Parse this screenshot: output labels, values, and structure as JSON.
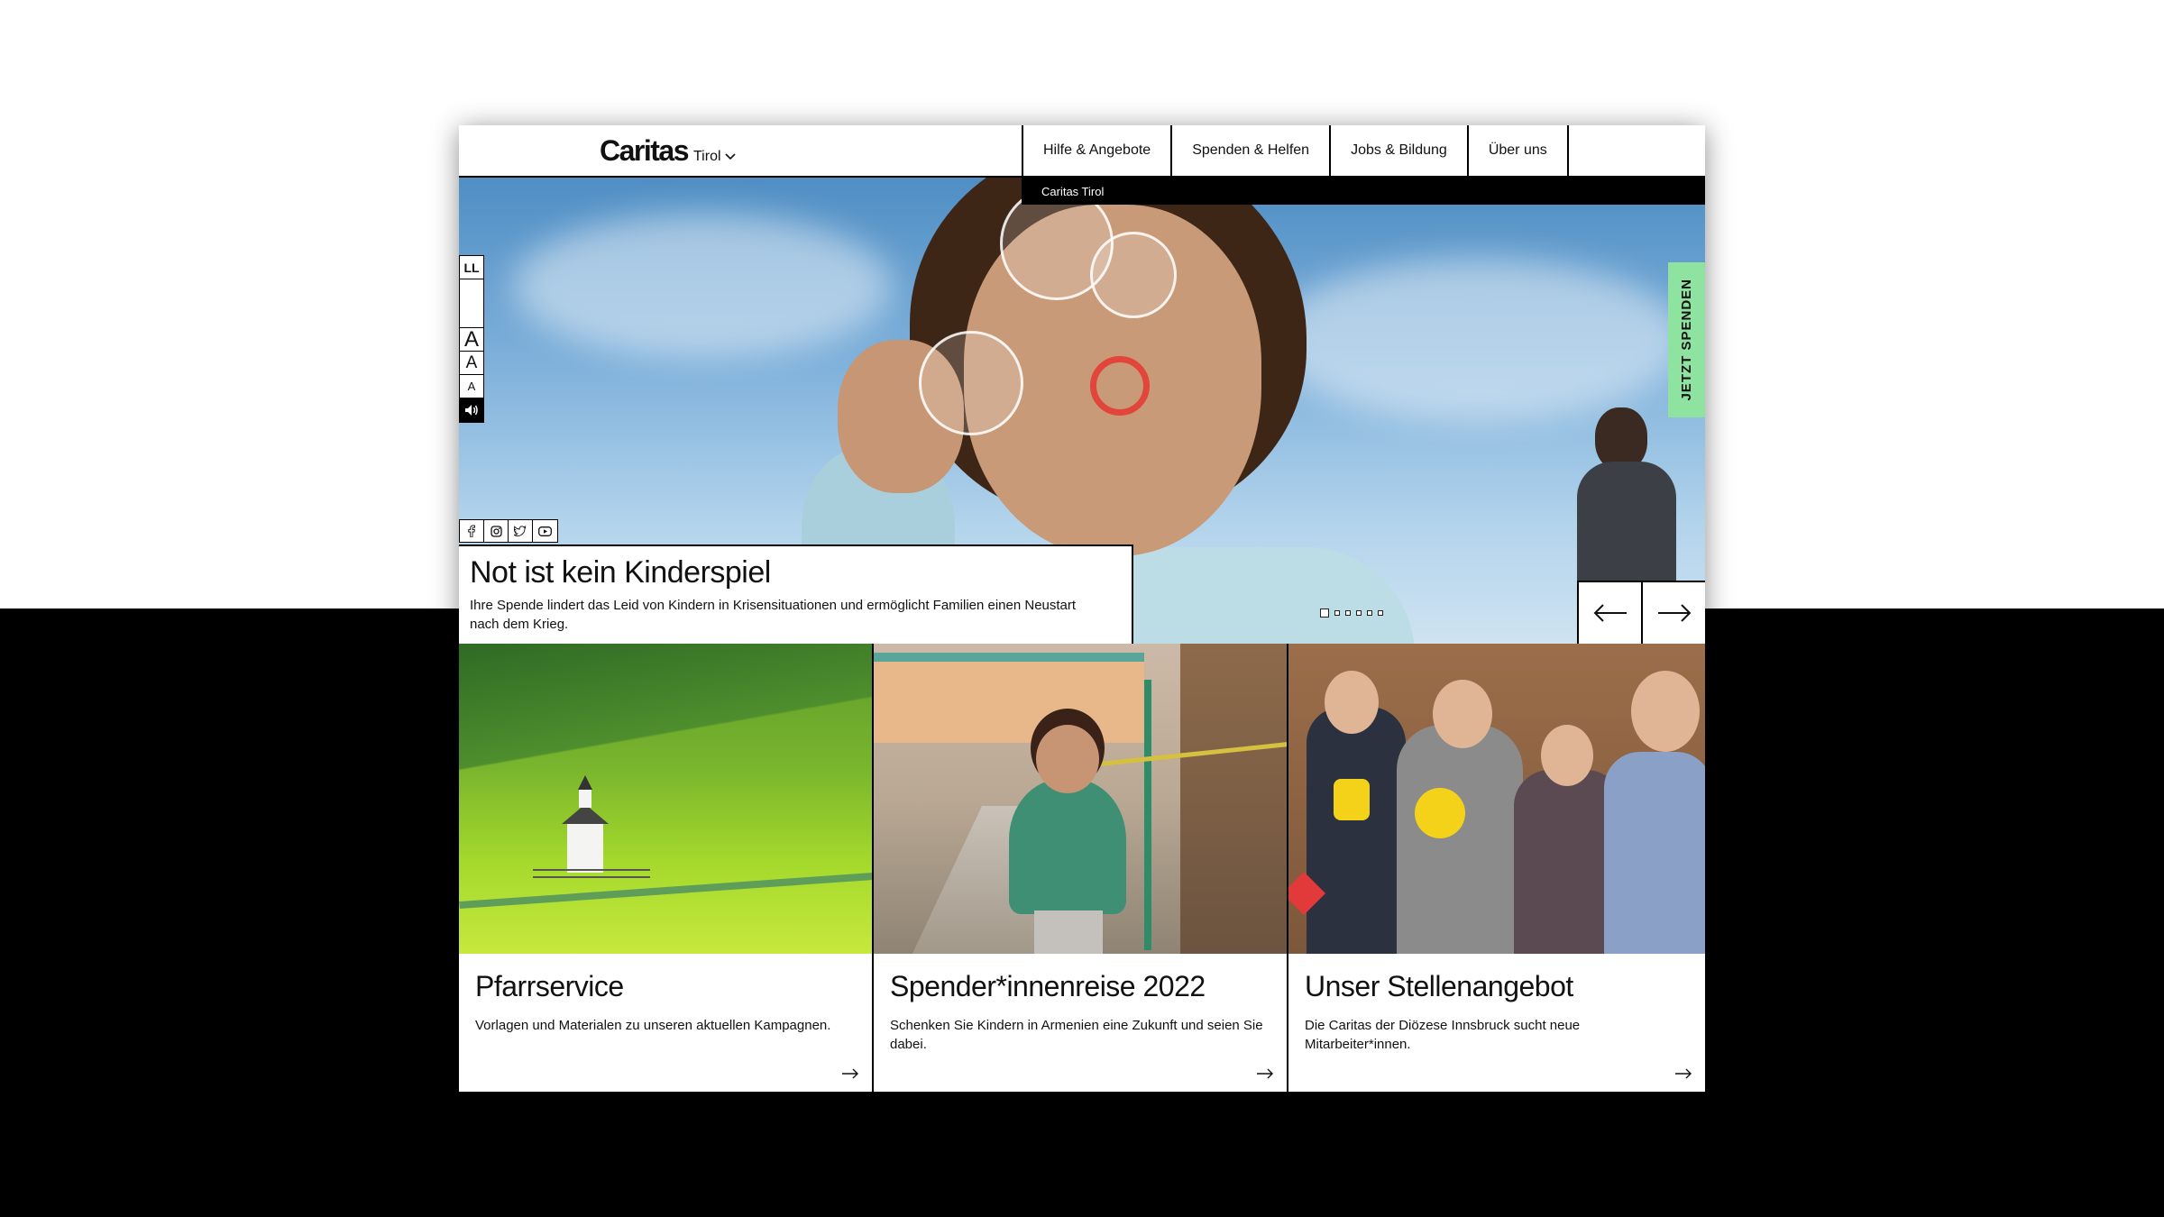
{
  "header": {
    "logo": "Caritas",
    "region": "Tirol",
    "nav": [
      "Hilfe & Angebote",
      "Spenden & Helfen",
      "Jobs & Bildung",
      "Über uns"
    ],
    "subbar": "Caritas Tirol"
  },
  "accessibility": {
    "easy_language": "LL",
    "font_large": "A",
    "font_medium": "A",
    "font_small": "A"
  },
  "social": [
    "facebook-icon",
    "instagram-icon",
    "twitter-icon",
    "youtube-icon"
  ],
  "hero": {
    "title": "Not ist kein Kinderspiel",
    "text": "Ihre Spende lindert das Leid von Kindern in Krisensituationen und ermöglicht Familien einen Neustart nach dem Krieg.",
    "slides_total": 6,
    "slide_active": 1,
    "donate_label": "JETZT SPENDEN"
  },
  "cards": [
    {
      "title": "Pfarrservice",
      "text": "Vorlagen und Materialen zu unseren aktuellen Kampagnen."
    },
    {
      "title": "Spender*innenreise 2022",
      "text": "Schenken Sie Kindern in Armenien eine Zukunft und seien Sie dabei."
    },
    {
      "title": "Unser Stellenangebot",
      "text": "Die Caritas der Diözese Innsbruck sucht neue Mitarbeiter*innen."
    }
  ],
  "colors": {
    "donate_accent": "#8fe3a0",
    "contrast_blue": "#1a2b8a",
    "contrast_yellow": "#f2e317"
  }
}
